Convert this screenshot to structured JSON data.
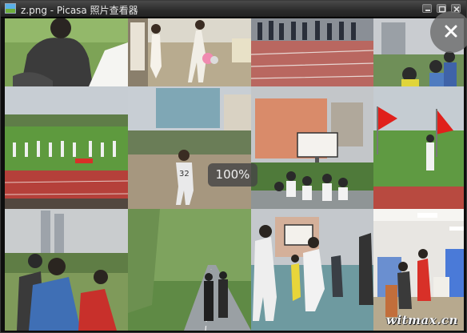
{
  "window": {
    "title": "z.png - Picasa 照片查看器"
  },
  "viewer": {
    "zoom_label": "100%"
  },
  "photos": [
    "seated-student",
    "kids-kicking-ball",
    "running-track-crowd",
    "students-holding-things",
    "stadium-assembly",
    "basketball-player",
    "basketball-hoop-crowd",
    "red-flags-field",
    "students-foreground",
    "tree-lined-road",
    "playground-basketball",
    "classroom"
  ],
  "watermark": "witmax.cn",
  "colors": {
    "titlebar": "#2b2b2b",
    "border": "#000000"
  }
}
